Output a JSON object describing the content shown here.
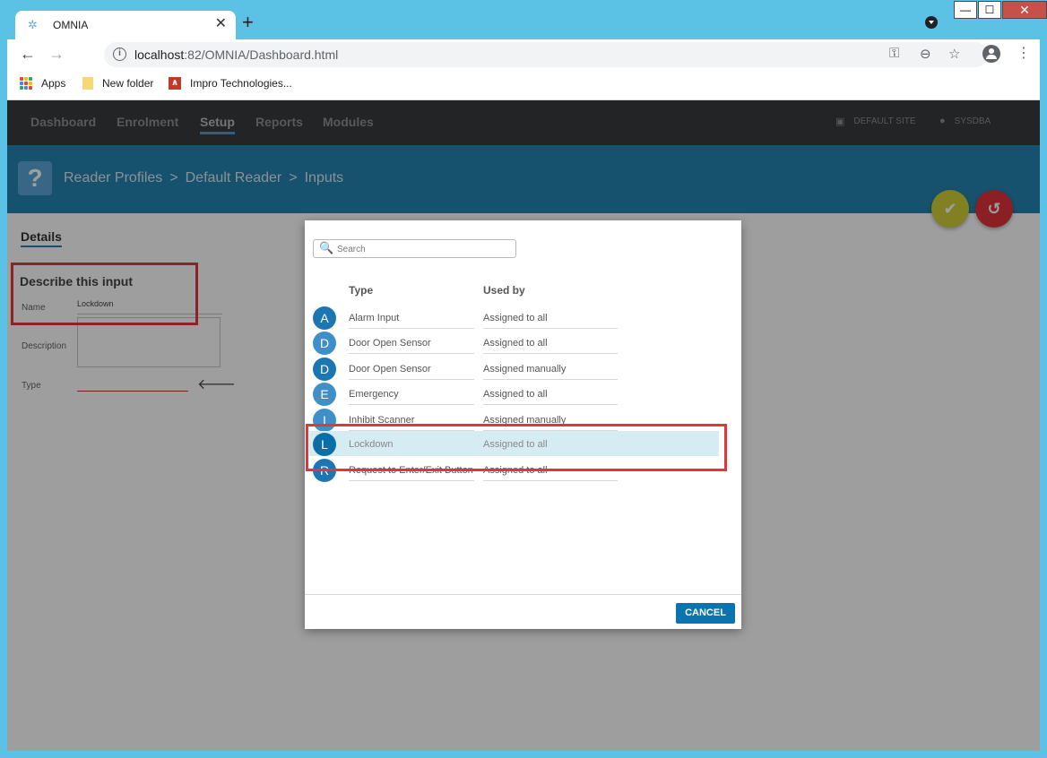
{
  "browser": {
    "tab_title": "OMNIA",
    "tab_close": "✕",
    "new_tab": "+",
    "url_host": "localhost",
    "url_path": ":82/OMNIA/Dashboard.html",
    "bookmarks": [
      "Apps",
      "New folder",
      "Impro Technologies..."
    ],
    "window_controls": {
      "minimize": "—",
      "maximize": "☐",
      "close": "✕"
    }
  },
  "app_nav": {
    "items": [
      "Dashboard",
      "Enrolment",
      "Setup",
      "Reports",
      "Modules"
    ],
    "active": "Setup",
    "site": "DEFAULT SITE",
    "user": "SYSDBA"
  },
  "breadcrumb": {
    "icon": "?",
    "items": [
      "Reader Profiles",
      "Default Reader",
      "Inputs"
    ],
    "separator": ">"
  },
  "details": {
    "tab": "Details",
    "section_title": "Describe this input",
    "name_label": "Name",
    "name_value": "Lockdown",
    "description_label": "Description",
    "type_label": "Type"
  },
  "modal": {
    "search_placeholder": "Search",
    "columns": {
      "type": "Type",
      "used_by": "Used by"
    },
    "rows": [
      {
        "letter": "A",
        "type": "Alarm Input",
        "used_by": "Assigned to all",
        "color": "#1c76b4"
      },
      {
        "letter": "D",
        "type": "Door Open Sensor",
        "used_by": "Assigned to all",
        "color": "#3f8fc9"
      },
      {
        "letter": "D",
        "type": "Door Open Sensor",
        "used_by": "Assigned manually",
        "color": "#1c76b4"
      },
      {
        "letter": "E",
        "type": "Emergency",
        "used_by": "Assigned to all",
        "color": "#3f8fc9"
      },
      {
        "letter": "I",
        "type": "Inhibit Scanner",
        "used_by": "Assigned manually",
        "color": "#3f8fc9"
      },
      {
        "letter": "L",
        "type": "Lockdown",
        "used_by": "Assigned to all",
        "color": "#0a6fa7",
        "selected": true
      },
      {
        "letter": "R",
        "type": "Request to Enter/Exit Button",
        "used_by": "Assigned to all",
        "color": "#1c76b4"
      }
    ],
    "cancel_label": "CANCEL"
  },
  "colors": {
    "accent": "#2483b0",
    "highlight_border": "#e0373a",
    "ok_fab": "#d1d03a",
    "undo_fab": "#e0353b"
  }
}
